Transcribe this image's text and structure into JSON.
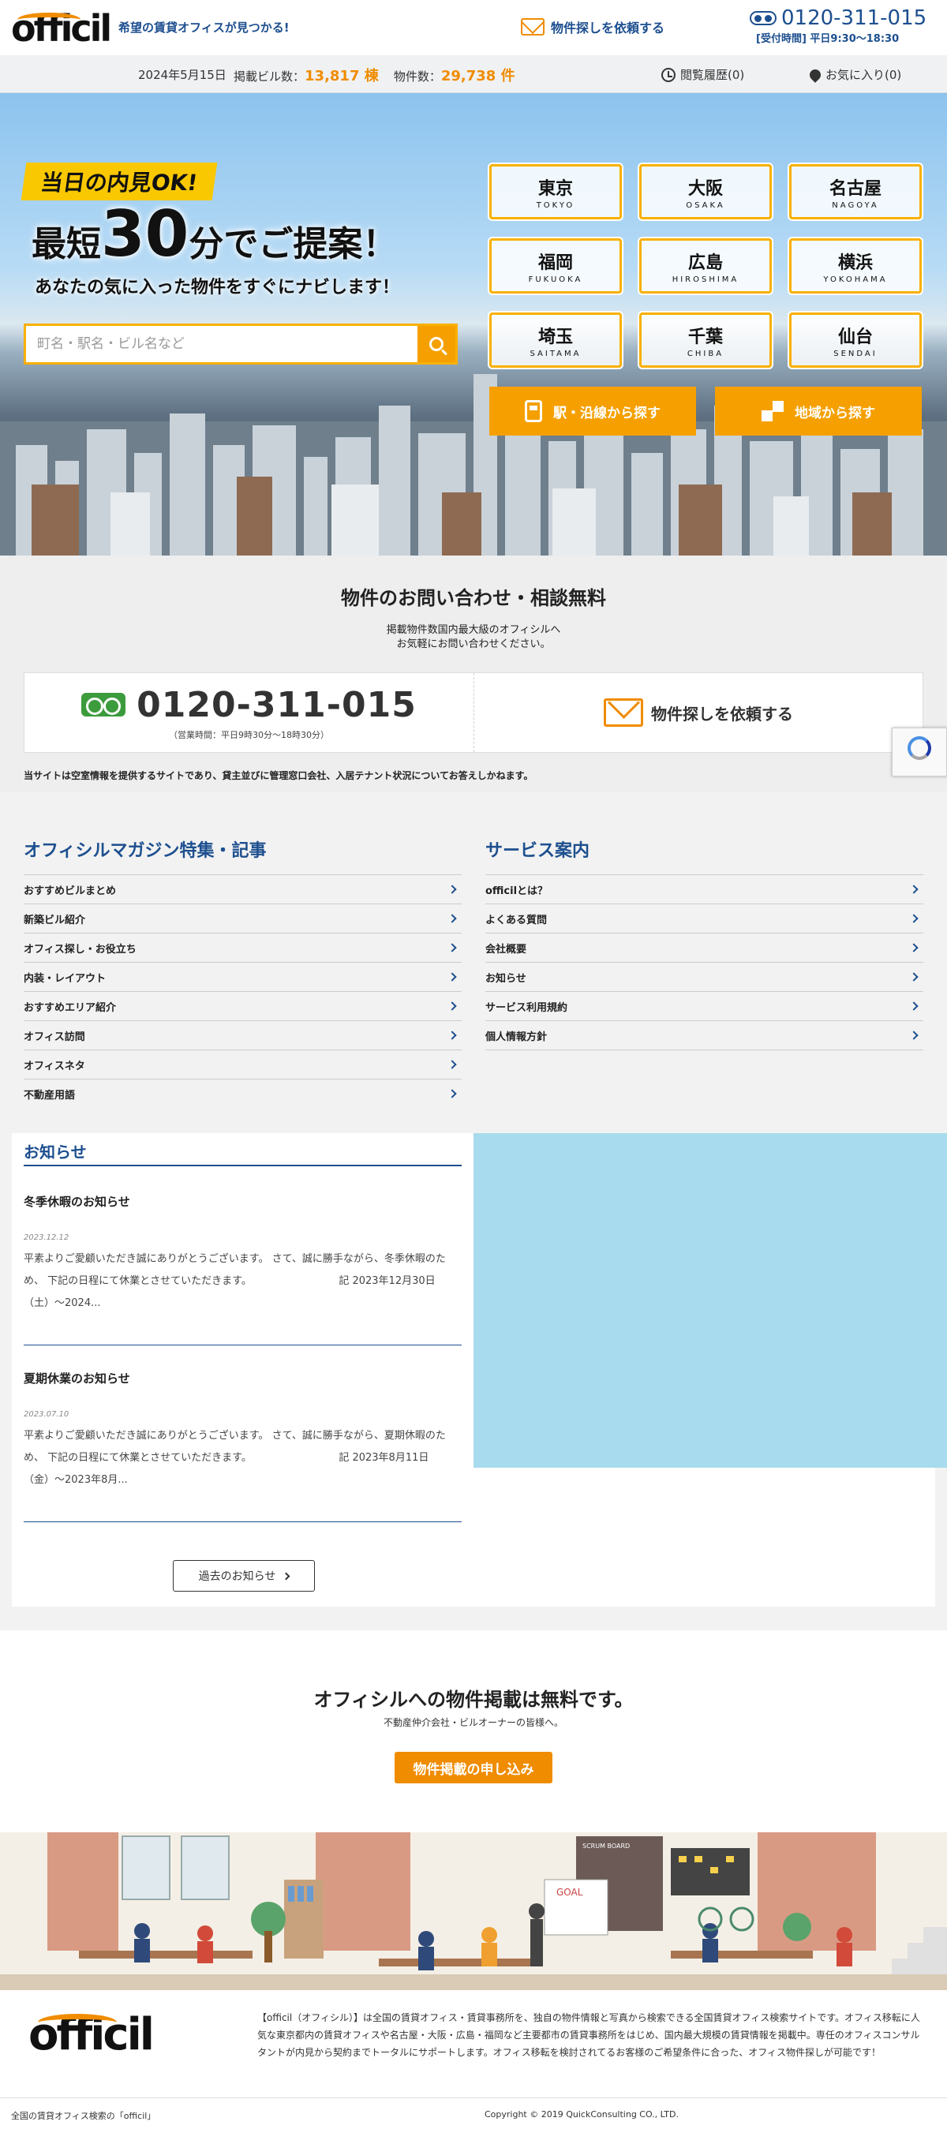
{
  "header": {
    "logo": "officil",
    "tagline": "希望の賃貸オフィスが見つかる!",
    "request_label": "物件探しを依頼する",
    "phone": "0120-311-015",
    "hours": "[受付時間] 平日9:30〜18:30"
  },
  "infobar": {
    "date": "2024年5月15日",
    "buildings_label": "掲載ビル数：",
    "buildings_value": "13,817 棟",
    "properties_label": "物件数：",
    "properties_value": "29,738 件",
    "history": "閲覧履歴(0)",
    "favorites": "お気に入り(0)"
  },
  "hero": {
    "badge": "当日の内見OK!",
    "headline_pre": "最短",
    "headline_big": "30",
    "headline_post": "分でご提案！",
    "sub": "あなたの気に入った物件をすぐにナビします！",
    "search_placeholder": "町名・駅名・ビル名など",
    "cities": [
      {
        "name": "東京",
        "roman": "TOKYO"
      },
      {
        "name": "大阪",
        "roman": "OSAKA"
      },
      {
        "name": "名古屋",
        "roman": "NAGOYA"
      },
      {
        "name": "福岡",
        "roman": "FUKUOKA"
      },
      {
        "name": "広島",
        "roman": "HIROSHIMA"
      },
      {
        "name": "横浜",
        "roman": "YOKOHAMA"
      },
      {
        "name": "埼玉",
        "roman": "SAITAMA"
      },
      {
        "name": "千葉",
        "roman": "CHIBA"
      },
      {
        "name": "仙台",
        "roman": "SENDAI"
      }
    ],
    "station_search": "駅・沿線から探す",
    "area_search": "地域から探す"
  },
  "contact": {
    "title": "物件のお問い合わせ・相談無料",
    "lead_1": "掲載物件数国内最大級のオフィシルへ",
    "lead_2": "お気軽にお問い合わせください。",
    "phone": "0120-311-015",
    "hours": "（営業時間：平日9時30分〜18時30分）",
    "request_label": "物件探しを依頼する",
    "note": "当サイトは空室情報を提供するサイトであり、貸主並びに管理窓口会社、入居テナント状況についてお答えしかねます。"
  },
  "magazine": {
    "title": "オフィシルマガジン特集・記事",
    "items": [
      "おすすめビルまとめ",
      "新築ビル紹介",
      "オフィス探し・お役立ち",
      "内装・レイアウト",
      "おすすめエリア紹介",
      "オフィス訪問",
      "オフィスネタ",
      "不動産用語"
    ]
  },
  "service": {
    "title": "サービス案内",
    "items": [
      "officilとは？",
      "よくある質問",
      "会社概要",
      "お知らせ",
      "サービス利用規約",
      "個人情報方針"
    ]
  },
  "news": {
    "title": "お知らせ",
    "items": [
      {
        "title": "冬季休暇のお知らせ",
        "date": "2023.12.12",
        "body": "平素よりご愛顧いただき誠にありがとうございます。 さて、誠に勝手ながら、冬季休暇のため、 下記の日程にて休業とさせていただきます。　　　　　　　　　記 2023年12月30日（土）〜2024..."
      },
      {
        "title": "夏期休業のお知らせ",
        "date": "2023.07.10",
        "body": "平素よりご愛顧いただき誠にありがとうございます。 さて、誠に勝手ながら、夏期休暇のため、 下記の日程にて休業とさせていただきます。　　　　　　　　　記 2023年8月11日（金）〜2023年8月..."
      }
    ],
    "past_label": "過去のお知らせ"
  },
  "listing": {
    "title": "オフィシルへの物件掲載は無料です。",
    "sub": "不動産仲介会社・ビルオーナーの皆様へ。",
    "button": "物件掲載の申し込み"
  },
  "illustration": {
    "board_label": "SCRUM BOARD",
    "goal_label": "GOAL"
  },
  "footer": {
    "logo": "officil",
    "description": "【officil（オフィシル）】は全国の賃貸オフィス・賃貸事務所を、独自の物件情報と写真から検索できる全国賃貸オフィス検索サイトです。オフィス移転に人気な東京都内の賃貸オフィスや名古屋・大阪・広島・福岡など主要都市の賃貸事務所をはじめ、国内最大規模の賃貸情報を掲載中。専任のオフィスコンサルタントが内見から契約までトータルにサポートします。オフィス移転を検討されてるお客様のご希望条件に合った、オフィス物件探しが可能です！",
    "left": "全国の賃貸オフィス検索の「officil」",
    "copyright": "Copyright © 2019 QuickConsulting CO., LTD."
  },
  "colors": {
    "brand_blue": "#1d4f8f",
    "accent_orange": "#f08c00",
    "hero_yellow": "#f9b000"
  }
}
